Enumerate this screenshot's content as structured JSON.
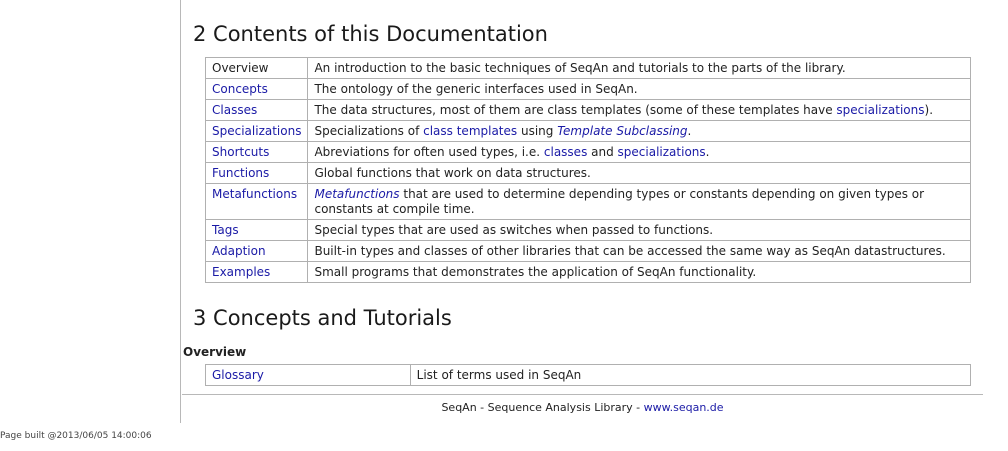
{
  "section2": {
    "heading": "2 Contents of this Documentation",
    "rows": [
      {
        "key": "Overview",
        "key_link": false,
        "desc": [
          {
            "t": "An introduction to the basic techniques of SeqAn and tutorials to the parts of the library."
          }
        ]
      },
      {
        "key": "Concepts",
        "key_link": true,
        "desc": [
          {
            "t": "The ontology of the generic interfaces used in SeqAn."
          }
        ]
      },
      {
        "key": "Classes",
        "key_link": true,
        "desc": [
          {
            "t": "The data structures, most of them are class templates (some of these templates have "
          },
          {
            "t": "specializations",
            "link": true
          },
          {
            "t": ")."
          }
        ]
      },
      {
        "key": "Specializations",
        "key_link": true,
        "desc": [
          {
            "t": "Specializations of "
          },
          {
            "t": "class templates",
            "link": true
          },
          {
            "t": " using "
          },
          {
            "t": "Template Subclassing",
            "link": true,
            "italic": true
          },
          {
            "t": "."
          }
        ]
      },
      {
        "key": "Shortcuts",
        "key_link": true,
        "desc": [
          {
            "t": "Abreviations for often used types, i.e. "
          },
          {
            "t": "classes",
            "link": true
          },
          {
            "t": " and "
          },
          {
            "t": "specializations",
            "link": true
          },
          {
            "t": "."
          }
        ]
      },
      {
        "key": "Functions",
        "key_link": true,
        "desc": [
          {
            "t": "Global functions that work on data structures."
          }
        ]
      },
      {
        "key": "Metafunctions",
        "key_link": true,
        "desc": [
          {
            "t": "Metafunctions",
            "link": true,
            "italic": true
          },
          {
            "t": " that are used to determine depending types or constants depending on given types or constants at compile time."
          }
        ]
      },
      {
        "key": "Tags",
        "key_link": true,
        "desc": [
          {
            "t": "Special types that are used as switches when passed to functions."
          }
        ]
      },
      {
        "key": "Adaption",
        "key_link": true,
        "desc": [
          {
            "t": "Built-in types and classes of other libraries that can be accessed the same way as SeqAn datastructures."
          }
        ]
      },
      {
        "key": "Examples",
        "key_link": true,
        "desc": [
          {
            "t": "Small programs that demonstrates the application of SeqAn functionality."
          }
        ]
      }
    ]
  },
  "section3": {
    "heading": "3 Concepts and Tutorials",
    "subheading": "Overview",
    "rows": [
      {
        "key": "Glossary",
        "key_link": true,
        "desc": [
          {
            "t": "List of terms used in SeqAn"
          }
        ]
      }
    ]
  },
  "footer": {
    "text": "SeqAn - Sequence Analysis Library - ",
    "link": "www.seqan.de"
  },
  "build_info": "Page built @2013/06/05 14:00:06",
  "colors": {
    "link": "#1a1aa6",
    "border": "#b0b0b0",
    "rule": "#b8b8b8"
  }
}
